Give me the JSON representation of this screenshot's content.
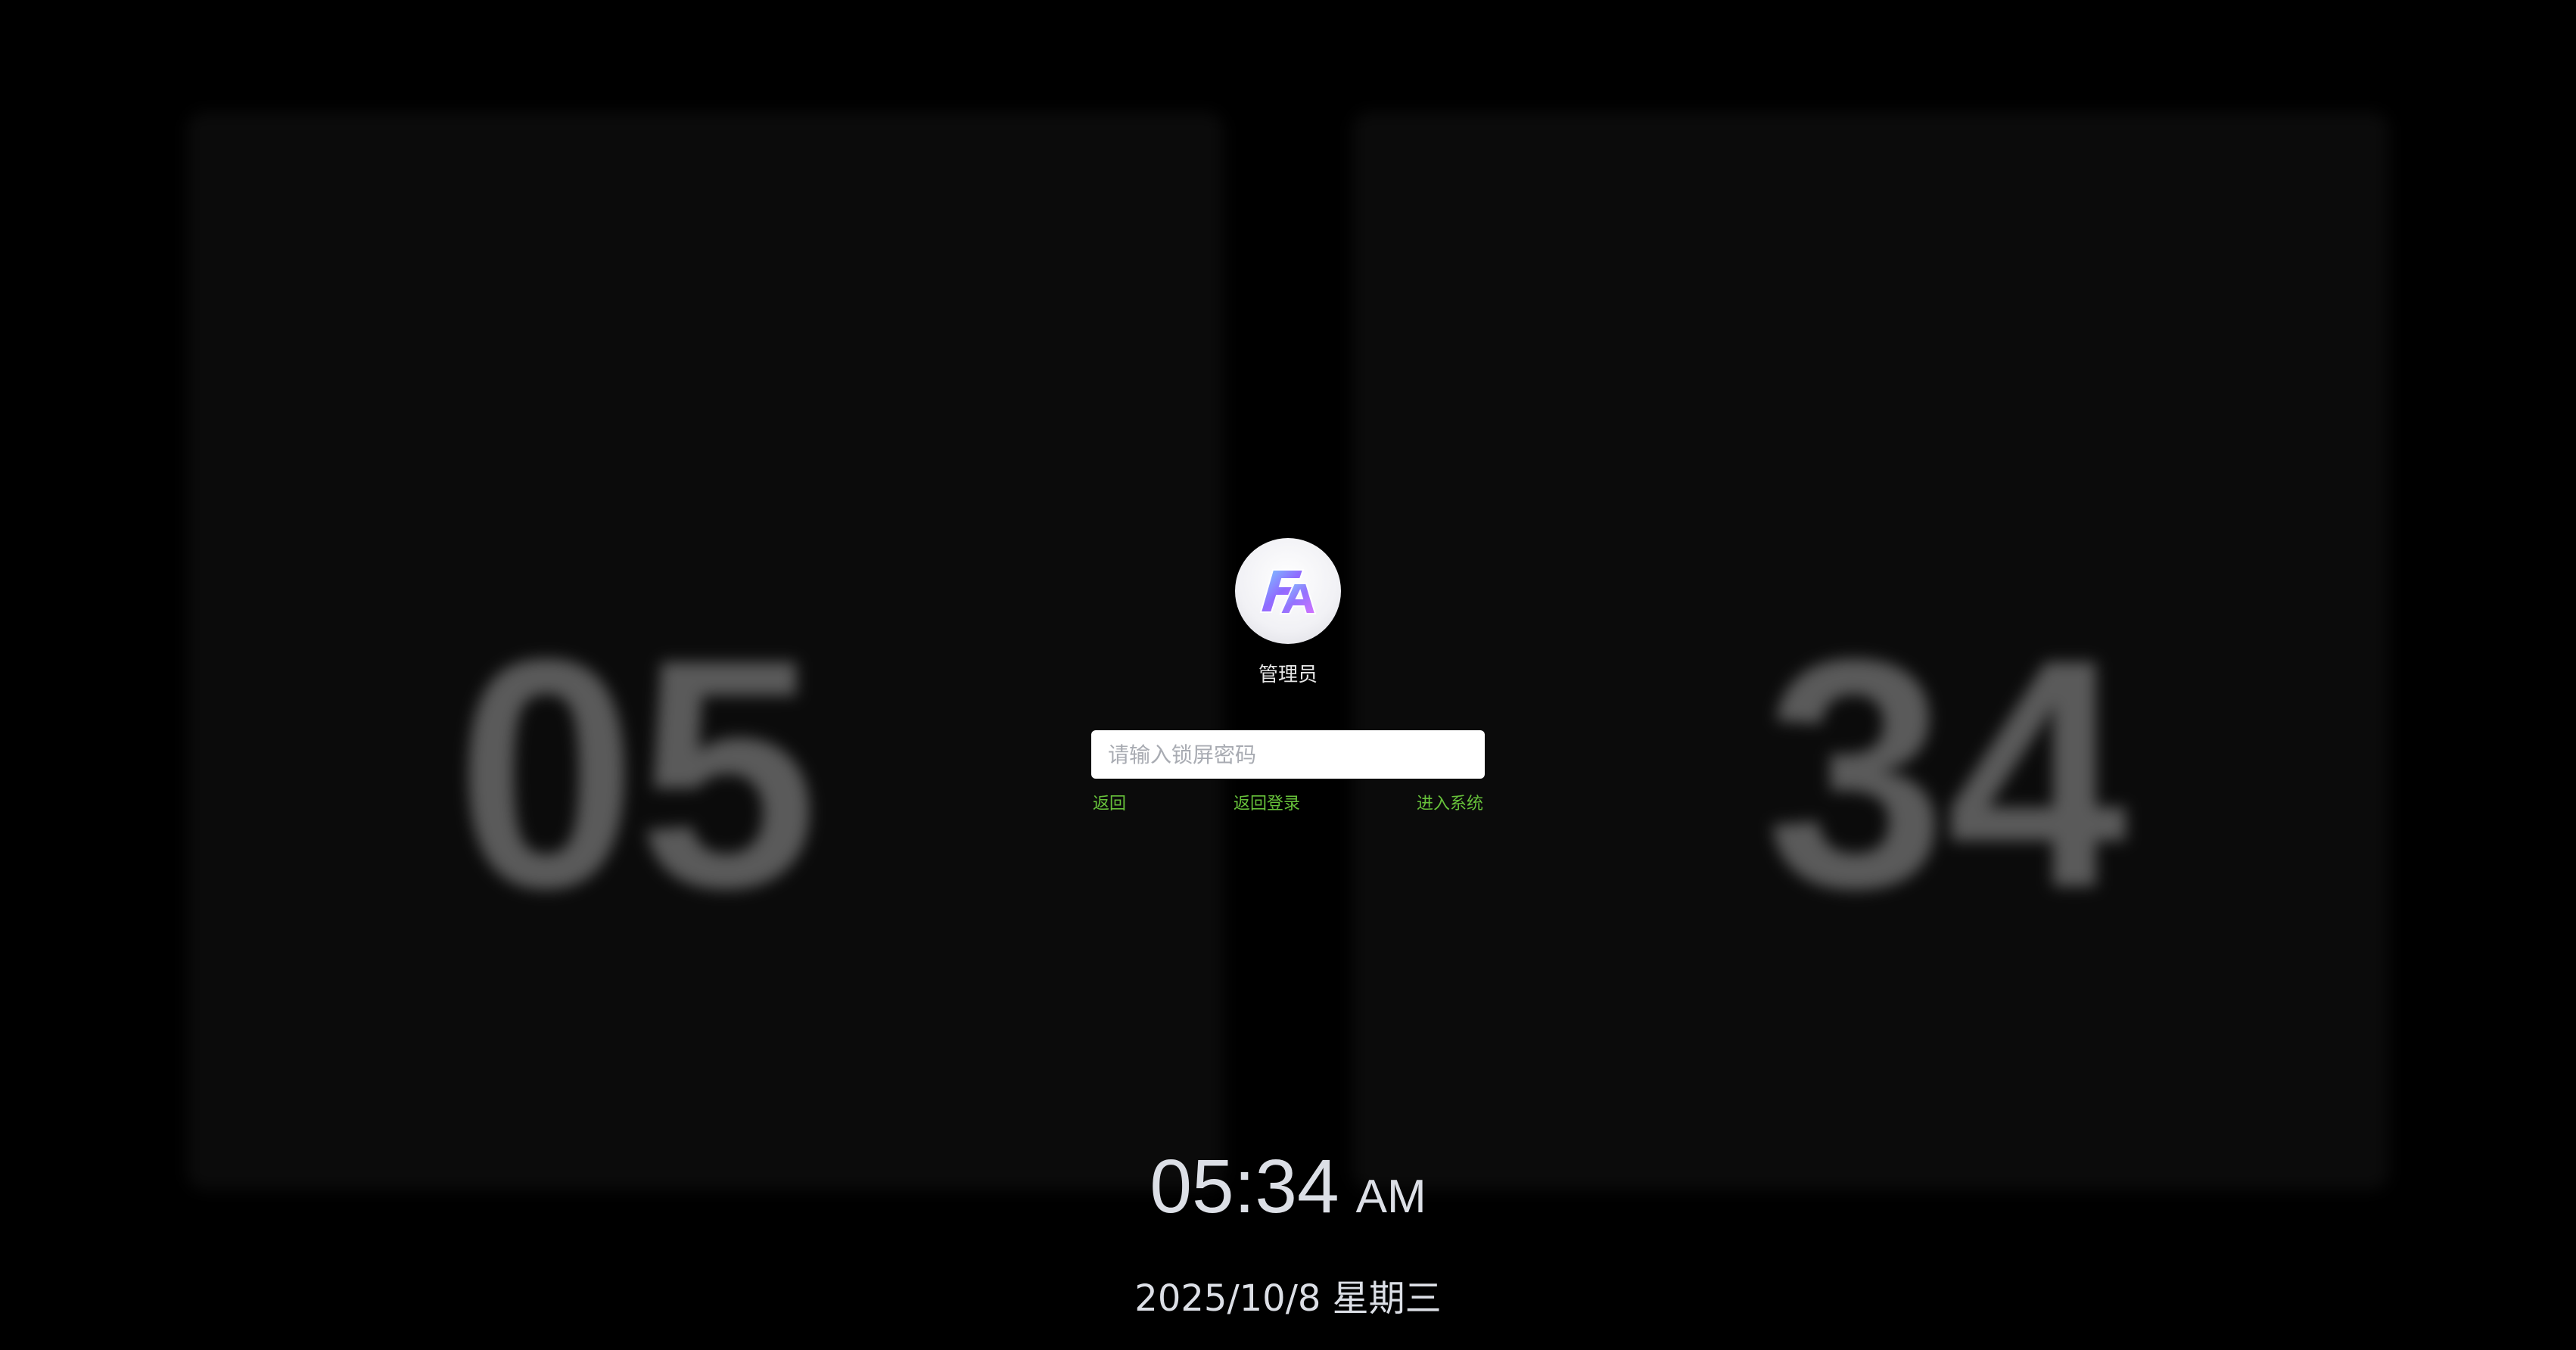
{
  "background": {
    "hours_digits": "05",
    "minutes_digits": "34"
  },
  "lock": {
    "username": "管理员",
    "password_placeholder": "请输入锁屏密码",
    "password_value": "",
    "links": {
      "back": "返回",
      "back_to_login": "返回登录",
      "enter_system": "进入系统"
    },
    "accent_color": "#67c23a"
  },
  "clock": {
    "time": "05:34",
    "period": "AM",
    "date": "2025/10/8 星期三"
  },
  "icons": {
    "avatar": "fa-logo-icon"
  }
}
